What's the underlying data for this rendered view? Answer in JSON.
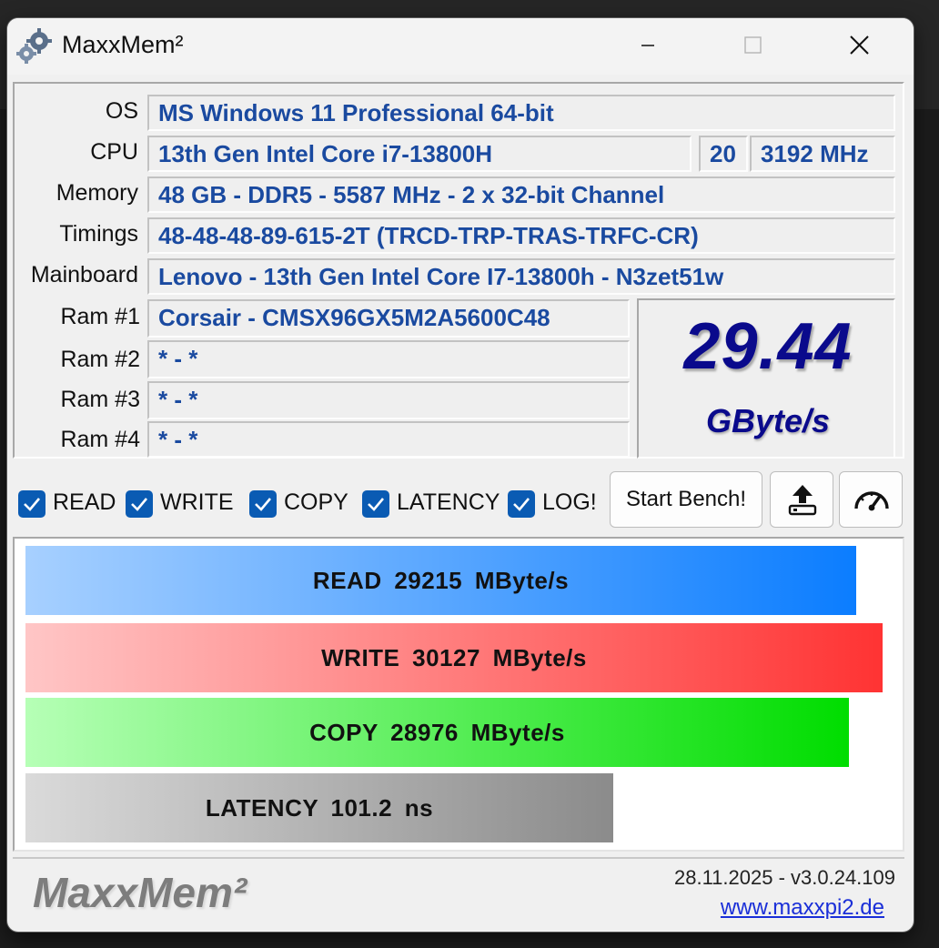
{
  "window": {
    "title": "MaxxMem²"
  },
  "system": {
    "os_label": "OS",
    "os": "MS Windows 11 Professional 64-bit",
    "cpu_label": "CPU",
    "cpu": "13th Gen Intel Core i7-13800H",
    "cpu_threads": "20",
    "cpu_clock": "3192 MHz",
    "memory_label": "Memory",
    "memory": "48 GB - DDR5 - 5587 MHz - 2 x 32-bit Channel",
    "timings_label": "Timings",
    "timings": "48-48-48-89-615-2T (TRCD-TRP-TRAS-TRFC-CR)",
    "mainboard_label": "Mainboard",
    "mainboard": "Lenovo - 13th Gen Intel Core I7-13800h - N3zet51w",
    "ram": [
      {
        "label": "Ram #1",
        "value": "Corsair - CMSX96GX5M2A5600C48"
      },
      {
        "label": "Ram #2",
        "value": "* - *"
      },
      {
        "label": "Ram #3",
        "value": "* - *"
      },
      {
        "label": "Ram #4",
        "value": "* - *"
      }
    ]
  },
  "score": {
    "value": "29.44",
    "unit": "GByte/s"
  },
  "options": [
    {
      "label": "READ",
      "checked": true
    },
    {
      "label": "WRITE",
      "checked": true
    },
    {
      "label": "COPY",
      "checked": true
    },
    {
      "label": "LATENCY",
      "checked": true
    },
    {
      "label": "LOG!",
      "checked": true
    }
  ],
  "buttons": {
    "start": "Start Bench!",
    "upload_icon": "upload-icon",
    "gauge_icon": "speedometer-icon"
  },
  "results": [
    {
      "name": "READ",
      "value": "29215",
      "unit": "MByte/s",
      "fill": 0.955,
      "color": "#0b7dff"
    },
    {
      "name": "WRITE",
      "value": "30127",
      "unit": "MByte/s",
      "fill": 0.985,
      "color": "#ff3333"
    },
    {
      "name": "COPY",
      "value": "28976",
      "unit": "MByte/s",
      "fill": 0.947,
      "color": "#00dd00"
    },
    {
      "name": "LATENCY",
      "value": "101.2",
      "unit": "ns",
      "fill": 0.676,
      "color": "#8b8b8b"
    }
  ],
  "footer": {
    "logo": "MaxxMem²",
    "version": "28.11.2025 - v3.0.24.109",
    "link": "www.maxxpi2.de"
  }
}
